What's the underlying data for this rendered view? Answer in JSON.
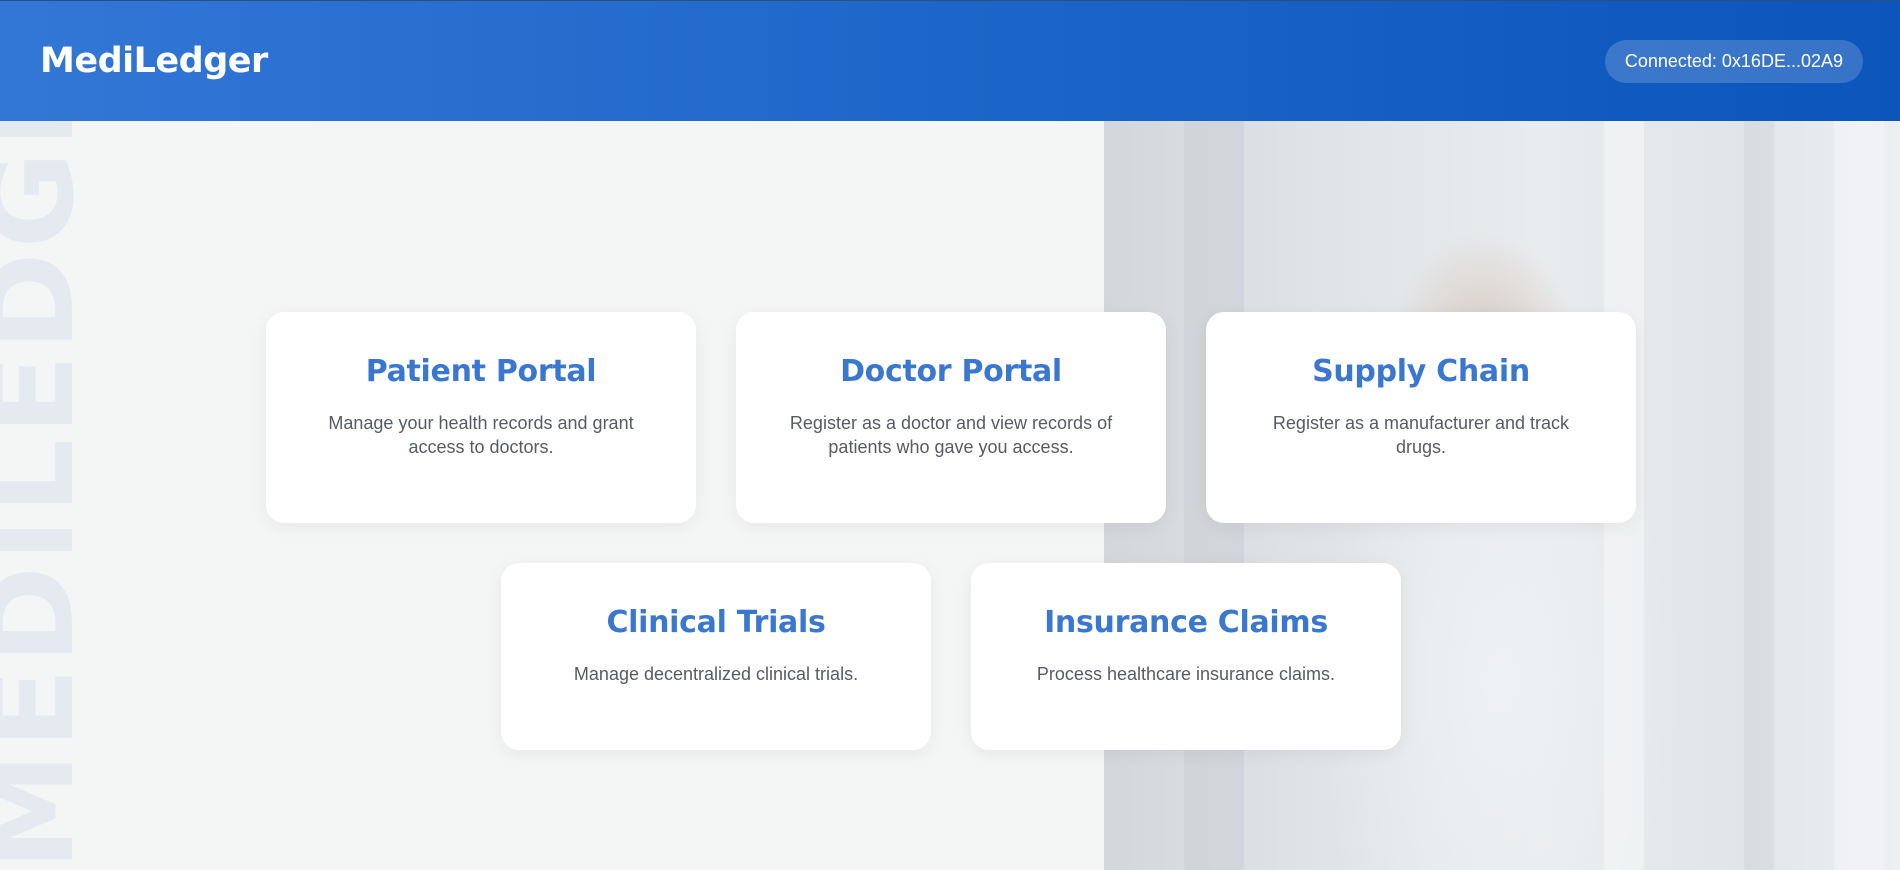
{
  "header": {
    "brand": "MediLedger",
    "wallet_status": "Connected: 0x16DE...02A9"
  },
  "watermark": {
    "text": "MEDILEDGER"
  },
  "cards": [
    {
      "title": "Patient Portal",
      "description": "Manage your health records and grant access to doctors."
    },
    {
      "title": "Doctor Portal",
      "description": "Register as a doctor and view records of patients who gave you access."
    },
    {
      "title": "Supply Chain",
      "description": "Register as a manufacturer and track drugs."
    },
    {
      "title": "Clinical Trials",
      "description": "Manage decentralized clinical trials."
    },
    {
      "title": "Insurance Claims",
      "description": "Process healthcare insurance claims."
    }
  ],
  "colors": {
    "header_gradient_start": "#3377d6",
    "header_gradient_end": "#0b55bb",
    "card_title": "#3a78d0",
    "background": "#f4f6f6"
  }
}
